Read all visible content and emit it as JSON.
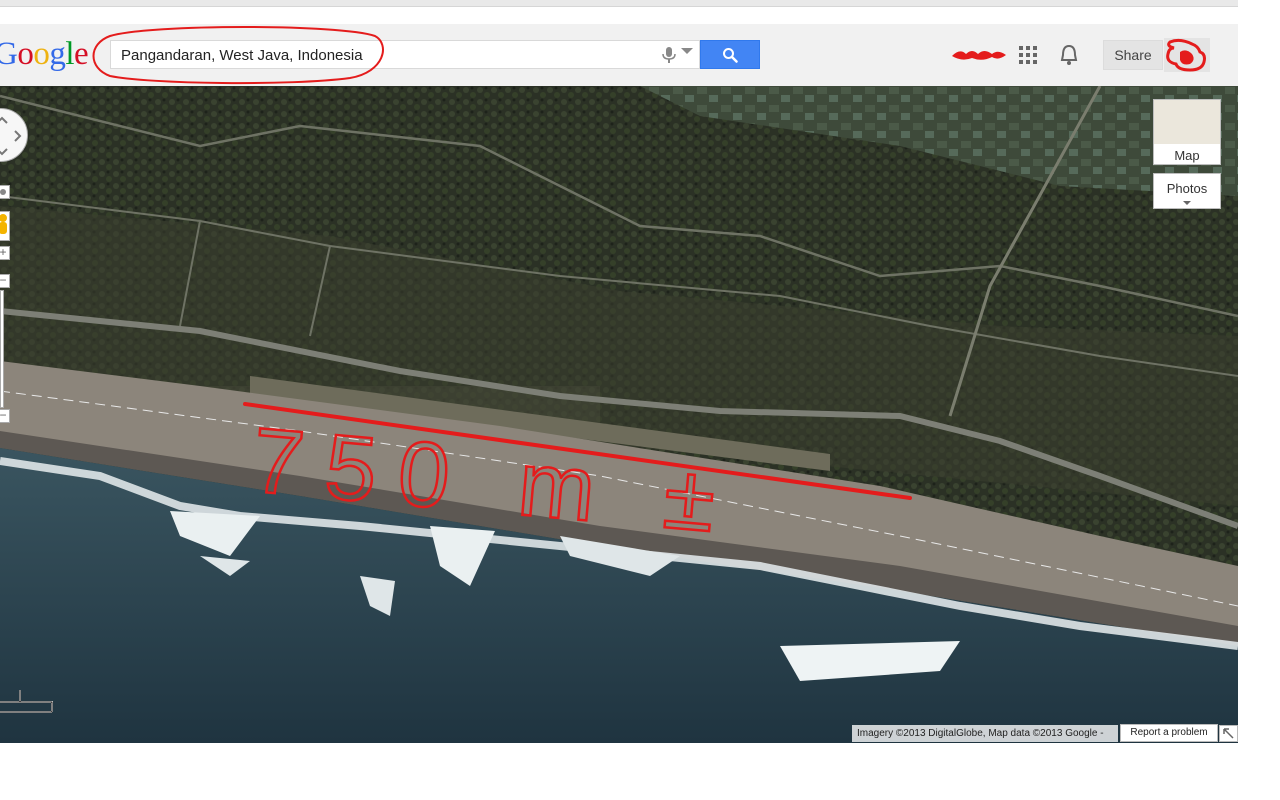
{
  "header": {
    "logo_text": "Google",
    "logo_colors": [
      "#3369e8",
      "#d50f25",
      "#eeb211",
      "#3369e8",
      "#009925",
      "#d50f25"
    ],
    "search_value": "Pangandaran, West Java, Indonesia",
    "share_label": "Share",
    "icons": {
      "mic": "microphone-icon",
      "search": "search-icon",
      "apps": "apps-grid-icon",
      "notifications": "bell-icon"
    }
  },
  "map": {
    "view": "satellite",
    "annotation": {
      "label": "750 m ±",
      "color": "#e41c1c"
    },
    "map_type_label": "Map",
    "photos_label": "Photos",
    "attribution": "Imagery ©2013 DigitalGlobe, Map data ©2013 Google -",
    "report_label": "Report a problem"
  },
  "colors": {
    "accent": "#4285f4",
    "annotation": "#e41c1c"
  }
}
